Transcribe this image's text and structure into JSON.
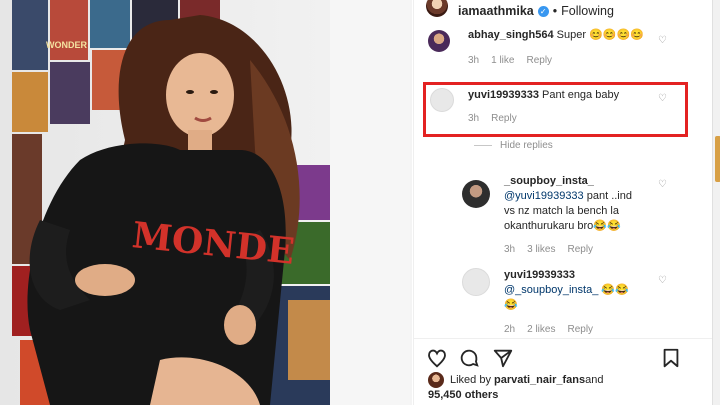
{
  "post": {
    "author": "iamaathmika",
    "separator": "•",
    "follow_status": "Following"
  },
  "comments": [
    {
      "user": "abhay_singh564",
      "text": "Super 😊😊😊😊",
      "time": "3h",
      "likes": "1 like",
      "reply": "Reply"
    },
    {
      "user": "yuvi19939333",
      "text": "Pant enga baby",
      "time": "3h",
      "reply": "Reply"
    }
  ],
  "hide_replies": "Hide replies",
  "replies": [
    {
      "user": "_soupboy_insta_",
      "mention": "@yuvi19939333",
      "text_line1": " pant ..ind",
      "text_line2": "vs nz match la bench la",
      "text_line3": "okanthurukaru bro😂😂",
      "time": "3h",
      "likes": "3 likes",
      "reply": "Reply"
    },
    {
      "user": "yuvi19939333",
      "mention": "@_soupboy_insta_",
      "text_line1": " 😂😂",
      "text_line2": "😂",
      "time": "2h",
      "likes": "2 likes",
      "reply": "Reply"
    }
  ],
  "liked_by": {
    "prefix": "Liked by ",
    "user": "parvati_nair_fans",
    "and": " and",
    "count": "95,450 others"
  },
  "photo_sweatshirt_text": "MONDE",
  "poster_text": "WONDER",
  "colors": {
    "highlight": "#e32222",
    "verified": "#3897f0",
    "meta": "#8e8e8e"
  }
}
